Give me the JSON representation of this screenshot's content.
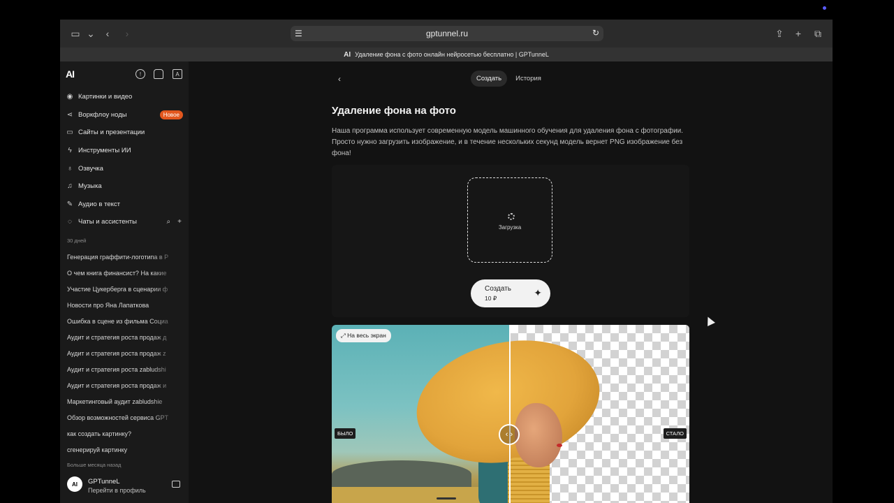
{
  "browser": {
    "url": "gptunnel.ru",
    "tab_title": "Удаление фона с фото онлайн нейросетью бесплатно | GPTunneL",
    "tab_logo": "AI"
  },
  "sidebar": {
    "logo": "AI",
    "nav": [
      {
        "icon": "image-icon",
        "label": "Картинки и видео"
      },
      {
        "icon": "share-icon",
        "label": "Воркфлоу ноды",
        "badge": "Новое"
      },
      {
        "icon": "monitor-icon",
        "label": "Сайты и презентации"
      },
      {
        "icon": "lightning-icon",
        "label": "Инструменты ИИ"
      },
      {
        "icon": "mic-icon",
        "label": "Озвучка"
      },
      {
        "icon": "music-icon",
        "label": "Музыка"
      },
      {
        "icon": "pen-icon",
        "label": "Аудио в текст"
      },
      {
        "icon": "chat-icon",
        "label": "Чаты и ассистенты"
      }
    ],
    "section_30": "30 дней",
    "history": [
      "Генерация граффити-логотипа в Р",
      "О чем книга финансист? На какие",
      "Участие Цукерберга в сценарии ф",
      "Новости про Яна Лапаткова",
      "Ошибка в сцене из фильма Социа",
      "Аудит и стратегия роста продаж д",
      "Аудит и стратегия роста продаж z",
      "Аудит и стратегия роста zabludshi",
      "Аудит и стратегия роста продаж и",
      "Маркетинговый аудит zabludshie",
      "Обзор возможностей сервиса GPT",
      "как создать картинку?",
      "сгенерируй картинку"
    ],
    "section_older": "Больше месяца назад",
    "profile": {
      "name": "GPTunneL",
      "sub": "Перейти в профиль",
      "avatar": "AI"
    }
  },
  "main": {
    "tabs": [
      "Создать",
      "История"
    ],
    "title": "Удаление фона на фото",
    "description": "Наша программа использует современную модель машинного обучения для удаления фона с фотографии. Просто нужно загрузить изображение, и в течение нескольких секунд модель вернет PNG изображение без фона!",
    "upload_label": "Загрузка",
    "create_label": "Создать",
    "create_price": "10 ₽",
    "fullscreen_label": "На весь экран",
    "before_label": "БЫЛО",
    "after_label": "СТАЛО"
  }
}
